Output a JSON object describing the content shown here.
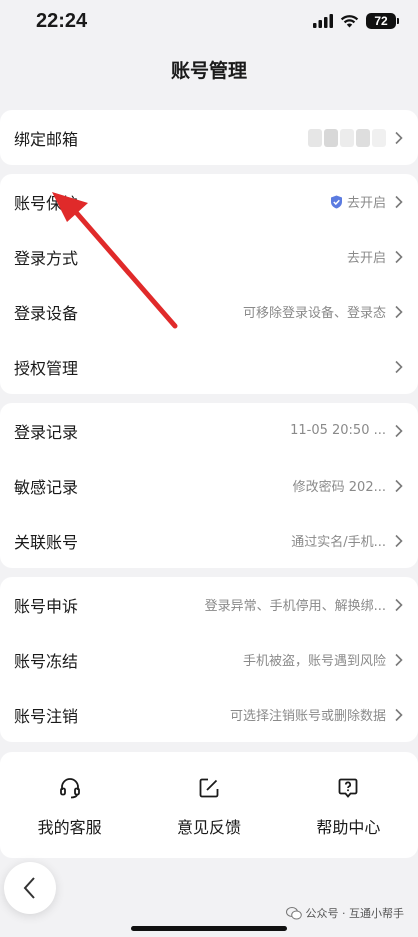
{
  "status_bar": {
    "time": "22:24",
    "battery": "72"
  },
  "header": {
    "title": "账号管理"
  },
  "group_email": {
    "rows": [
      {
        "label": "绑定邮箱",
        "value": ""
      }
    ]
  },
  "group_security": {
    "rows": [
      {
        "label": "账号保护",
        "value": "去开启",
        "icon": "shield-check-icon"
      },
      {
        "label": "登录方式",
        "value": "去开启"
      },
      {
        "label": "登录设备",
        "value": "可移除登录设备、登录态"
      },
      {
        "label": "授权管理",
        "value": ""
      }
    ]
  },
  "group_records": {
    "rows": [
      {
        "label": "登录记录",
        "value": "11-05 20:50 ..."
      },
      {
        "label": "敏感记录",
        "value": "修改密码 202..."
      },
      {
        "label": "关联账号",
        "value": "通过实名/手机..."
      }
    ]
  },
  "group_appeal": {
    "rows": [
      {
        "label": "账号申诉",
        "value": "登录异常、手机停用、解换绑..."
      },
      {
        "label": "账号冻结",
        "value": "手机被盗，账号遇到风险"
      },
      {
        "label": "账号注销",
        "value": "可选择注销账号或删除数据"
      }
    ]
  },
  "quick_actions": [
    {
      "label": "我的客服",
      "icon": "headset-icon"
    },
    {
      "label": "意见反馈",
      "icon": "edit-icon"
    },
    {
      "label": "帮助中心",
      "icon": "help-icon"
    }
  ],
  "watermark": {
    "text": "公众号 · 互通小帮手"
  },
  "colors": {
    "accent_shield": "#5b7be0",
    "annotation_arrow": "#e02a2a",
    "background": "#f2f2f4"
  }
}
